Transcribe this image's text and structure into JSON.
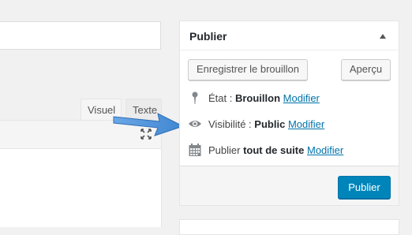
{
  "editor": {
    "tabs": [
      {
        "label": "Visuel"
      },
      {
        "label": "Texte"
      }
    ],
    "fullscreen_icon": "fullscreen-icon"
  },
  "publish": {
    "title": "Publier",
    "draft_button": "Enregistrer le brouillon",
    "preview_button": "Aperçu",
    "status": {
      "label": "État : ",
      "value": "Brouillon",
      "link": "Modifier",
      "icon": "pin-icon"
    },
    "visibility": {
      "label": "Visibilité : ",
      "value": "Public",
      "link": "Modifier",
      "icon": "eye-icon"
    },
    "schedule": {
      "label": "Publier ",
      "value": "tout de suite",
      "link": "Modifier",
      "icon": "calendar-icon"
    },
    "publish_button": "Publier"
  },
  "colors": {
    "accent": "#0085ba",
    "link": "#0073aa",
    "arrow": "#4a90d9"
  }
}
